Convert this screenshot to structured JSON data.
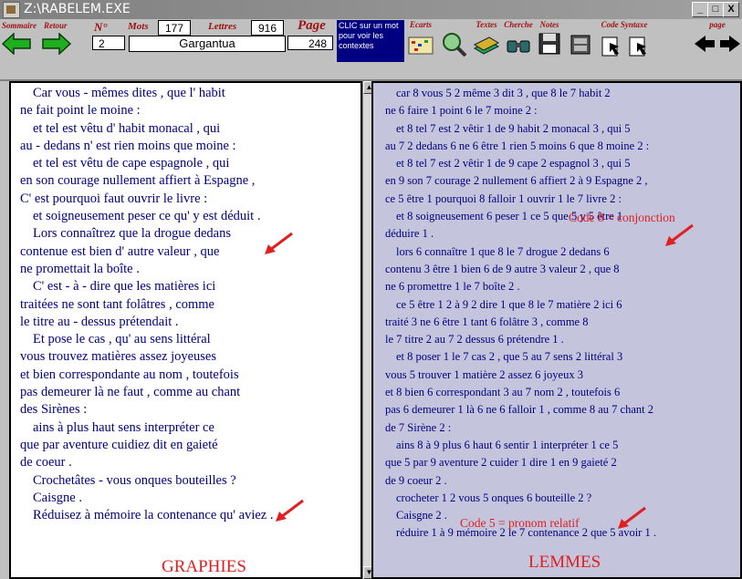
{
  "window": {
    "title": "Z:\\RABELEM.EXE",
    "controls": [
      "_",
      "□",
      "X"
    ]
  },
  "toolbar": {
    "sommaire": "Sommaire",
    "retour": "Retour",
    "n_label": "N°",
    "n_value": "2",
    "mots_label": "Mots",
    "mots_value": "177",
    "lettres_label": "Lettres",
    "lettres_value": "916",
    "title_value": "Gargantua",
    "page_label": "Page",
    "page_value": "248",
    "clic_text": "CLIC sur un mot pour voir les contextes",
    "tools": [
      {
        "label": "Ecarts"
      },
      {
        "label": ""
      },
      {
        "label": "Textes"
      },
      {
        "label": "Cherche"
      },
      {
        "label": "Notes"
      },
      {
        "label": ""
      },
      {
        "label": "Code Syntaxe"
      },
      {
        "label": "page"
      }
    ]
  },
  "left_panel": {
    "lines": [
      "Car vous - mêmes dites , que l' habit",
      "ne fait point le moine :",
      "et tel est vêtu d' habit monacal , qui",
      "au - dedans n' est rien moins que moine :",
      "et tel est vêtu de cape espagnole , qui",
      "en son courage nullement affiert à Espagne ,",
      "C' est pourquoi faut ouvrir le livre :",
      "et soigneusement peser ce qu' y est déduit .",
      "Lors connaîtrez que la drogue dedans",
      "contenue est bien d' autre valeur , que",
      "ne promettait la boîte .",
      "C' est - à - dire que les matières ici",
      "traitées ne sont tant folâtres , comme",
      "le titre au - dessus prétendait .",
      "Et pose le cas , qu' au sens littéral",
      "vous trouvez matières assez joyeuses",
      "et bien correspondante au nom , toutefois",
      "pas demeurer là ne faut , comme au chant",
      "des Sirènes :",
      "ains à plus haut sens interpréter ce",
      "que par aventure cuidiez dit en gaieté",
      "de coeur .",
      "Crochetâtes - vous onques bouteilles ?",
      "Caisgne .",
      "Réduisez à mémoire la contenance qu' aviez ."
    ],
    "bottom_label": "GRAPHIES"
  },
  "right_panel": {
    "lines": [
      "car 8 vous 5  2 même 3 dit 3 , que 8 le 7 habit 2",
      "ne 6 faire 1 point 6 le 7 moine 2 :",
      "et 8 tel 7 est 2 vêtir 1 de 9 habit 2 monacal 3 , qui 5",
      "au 7  2 dedans 6 ne 6 être 1 rien 5 moins 6 que 8 moine 2 :",
      "et 8 tel 7 est 2 vêtir 1 de 9 cape 2 espagnol 3 , qui 5",
      "en 9 son 7 courage 2 nullement 6 affiert 2 à 9 Espagne 2 ,",
      "ce 5 être 1 pourquoi 8 falloir 1 ouvrir 1 le 7 livre 2 :",
      "et 8  soigneusement 6  peser 1  ce 5  que 5  y 5  être 1",
      "déduire 1 .",
      "lors 6 connaître 1 que 8 le 7 drogue 2 dedans 6",
      "contenu 3 être 1 bien 6 de 9 autre 3 valeur 2 , que 8",
      "ne 6 promettre 1 le 7 boîte 2 .",
      "ce 5 être 1  2 à 9  2 dire 1 que 8 le 7 matière 2 ici 6",
      "traité 3 ne 6 être 1 tant 6 folâtre 3 , comme 8",
      "le 7 titre 2 au 7  2 dessus 6 prétendre 1 .",
      "et 8 poser 1 le 7 cas 2 , que 5 au 7 sens 2 littéral 3",
      "vous 5 trouver 1 matière 2 assez 6 joyeux 3",
      "et 8 bien 6 correspondant 3 au 7 nom 2 , toutefois 6",
      "pas 6 demeurer 1 là 6 ne 6 falloir 1 , comme 8 au 7 chant 2",
      "de 7 Sirène 2 :",
      "ains 8 à 9 plus 6 haut 6 sentir 1 interpréter 1 ce 5",
      "que 5 par 9 aventure 2 cuider 1 dire 1 en 9 gaieté 2",
      "de 9 coeur 2 .",
      "crocheter 1  2 vous 5 onques 6 bouteille 2 ?",
      "Caisgne 2 .",
      "réduire 1 à 9 mémoire 2 le 7 contenance 2 que 5 avoir 1 ."
    ],
    "code8_label": "Code 8 = conjonction",
    "code5_label": "Code 5 = pronom relatif",
    "bottom_label": "LEMMES"
  },
  "colors": {
    "text_blue": "#000080",
    "annotation_red": "#e02020",
    "right_bg": "#c4c4dc"
  }
}
